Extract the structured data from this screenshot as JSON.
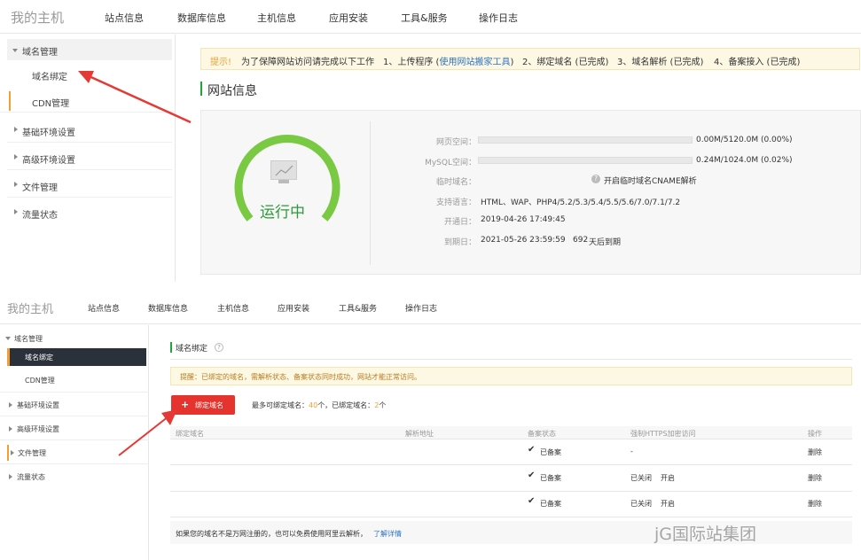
{
  "panel1": {
    "brand": "我的主机",
    "nav": [
      "站点信息",
      "数据库信息",
      "主机信息",
      "应用安装",
      "工具&服务",
      "操作日志"
    ],
    "sidebar": {
      "group": "域名管理",
      "sub": [
        "域名绑定",
        "CDN管理"
      ],
      "items": [
        "基础环境设置",
        "高级环境设置",
        "文件管理",
        "流量状态"
      ]
    },
    "notice": {
      "tip": "提示!",
      "text": "为了保障网站访问请完成以下工作",
      "step1_prefix": "1、上传程序 (",
      "step1_link": "使用网站搬家工具",
      "step1_suffix": ")",
      "step2": "2、绑定域名 (已完成)",
      "step3": "3、域名解析 (已完成)",
      "step4": "4、备案接入 (已完成)"
    },
    "section_title": "网站信息",
    "status_text": "运行中",
    "status_ring_fraction": 1.0,
    "rows": {
      "web_label": "网页空间：",
      "web_value": "0.00M/5120.0M (0.00%)",
      "mysql_label": "MySQL空间：",
      "mysql_value": "0.24M/1024.0M (0.02%)",
      "tmpdomain_label": "临时域名：",
      "tmpdomain_link": "开启临时域名CNAME解析",
      "lang_label": "支持语言：",
      "lang_value": "HTML、WAP、PHP4/5.2/5.3/5.4/5.5/5.6/7.0/7.1/7.2",
      "open_label": "开通日：",
      "open_value": "2019-04-26 17:49:45",
      "expire_label": "到期日：",
      "expire_value": "2021-05-26 23:59:59",
      "expire_days": "692",
      "expire_suffix": "天后到期"
    },
    "colors": {
      "ring": "#7ac943",
      "status_text": "#2e9a3a",
      "arrow": "#e53935"
    }
  },
  "panel2": {
    "brand": "我的主机",
    "nav": [
      "站点信息",
      "数据库信息",
      "主机信息",
      "应用安装",
      "工具&服务",
      "操作日志"
    ],
    "sidebar": {
      "group": "域名管理",
      "sub": [
        "域名绑定",
        "CDN管理"
      ],
      "items": [
        "基础环境设置",
        "高级环境设置",
        "文件管理",
        "流量状态"
      ]
    },
    "page_title": "域名绑定",
    "notice": "提醒：已绑定的域名，需解析状态、备案状态同时成功，网站才能正常访问。",
    "bind_button": "绑定域名",
    "limit_prefix": "最多可绑定域名：",
    "limit_max": "40",
    "limit_mid": "个，已绑定域名：",
    "limit_bound": "2",
    "limit_suffix": "个",
    "table": {
      "headers": [
        "绑定域名",
        "解析地址",
        "备案状态",
        "强制HTTPS加密访问",
        "操作"
      ],
      "rows": [
        {
          "beian": "已备案",
          "https": "-",
          "https_link": "",
          "action": "删除"
        },
        {
          "beian": "已备案",
          "https": "已关闭",
          "https_link": "开启",
          "action": "删除"
        },
        {
          "beian": "已备案",
          "https": "已关闭",
          "https_link": "开启",
          "action": "删除"
        }
      ]
    },
    "footer_text": "如果您的域名不是万网注册的，也可以免费使用阿里云解析，",
    "footer_link": "了解详情",
    "watermark": "jG国际站集团"
  }
}
